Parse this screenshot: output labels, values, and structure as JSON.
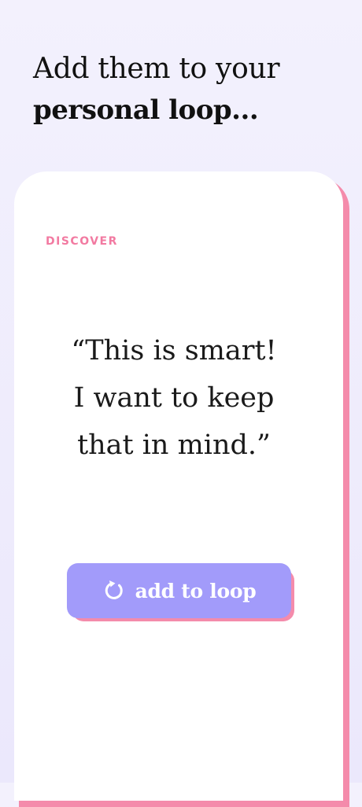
{
  "headline": {
    "line1": "Add them to your",
    "line2": "personal loop..."
  },
  "card": {
    "label": "DISCOVER",
    "quote_lines": [
      "“This is smart!",
      "I want to keep",
      "that in mind.”"
    ],
    "button": {
      "icon": "loop-icon",
      "label": "add to loop"
    }
  },
  "colors": {
    "background": "#efedfc",
    "card": "#ffffff",
    "accent_pink": "#f48bab",
    "label_pink": "#f27aa1",
    "button_purple": "#a29bfa",
    "text_dark": "#111111"
  }
}
